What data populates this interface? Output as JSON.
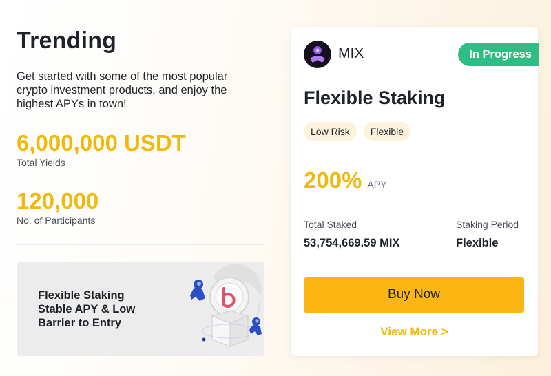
{
  "trending": {
    "title": "Trending",
    "description": "Get started with some of the most popular crypto investment products, and enjoy the highest APYs in town!",
    "stats": [
      {
        "value": "6,000,000 USDT",
        "label": "Total Yields"
      },
      {
        "value": "120,000",
        "label": "No. of Participants"
      }
    ],
    "banner": {
      "lines": [
        "Flexible Staking",
        "Stable APY & Low",
        "Barrier to Entry"
      ]
    }
  },
  "card": {
    "coin": "MIX",
    "status": "In Progress",
    "title": "Flexible Staking",
    "tags": [
      "Low Risk",
      "Flexible"
    ],
    "apy_value": "200%",
    "apy_label": "APY",
    "total_staked_label": "Total Staked",
    "total_staked_value": "53,754,669.59 MIX",
    "period_label": "Staking Period",
    "period_value": "Flexible",
    "buy_label": "Buy Now",
    "view_more_label": "View More >"
  },
  "colors": {
    "accent": "#f0b90b",
    "button": "#fcb614",
    "success": "#2ebd85",
    "text": "#1e2329"
  }
}
